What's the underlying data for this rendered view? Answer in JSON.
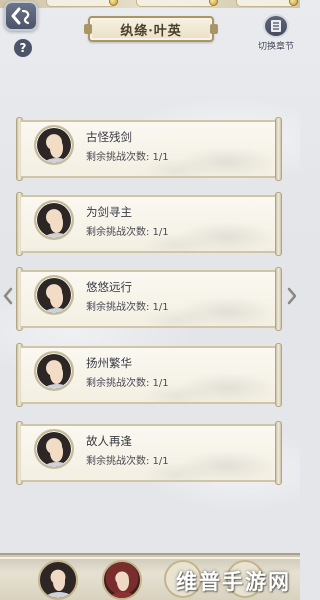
{
  "header": {
    "title": "纨绦·叶英",
    "chapter_switch_label": "切换章节"
  },
  "colors": {
    "accent": "#a99565",
    "button_dark": "#4c5468",
    "paper": "#f6f3ea"
  },
  "icons": {
    "back": "back-arrow-icon",
    "help": "question-icon",
    "chapter": "book-icon"
  },
  "help_label": "?",
  "challenges": [
    {
      "name": "古怪残剑",
      "remaining": "剩余挑战次数: 1/1"
    },
    {
      "name": "为剑寻主",
      "remaining": "剩余挑战次数: 1/1"
    },
    {
      "name": "悠悠远行",
      "remaining": "剩余挑战次数: 1/1"
    },
    {
      "name": "扬州繁华",
      "remaining": "剩余挑战次数: 1/1"
    },
    {
      "name": "故人再逢",
      "remaining": "剩余挑战次数: 1/1"
    }
  ],
  "watermark": "维普手游网"
}
